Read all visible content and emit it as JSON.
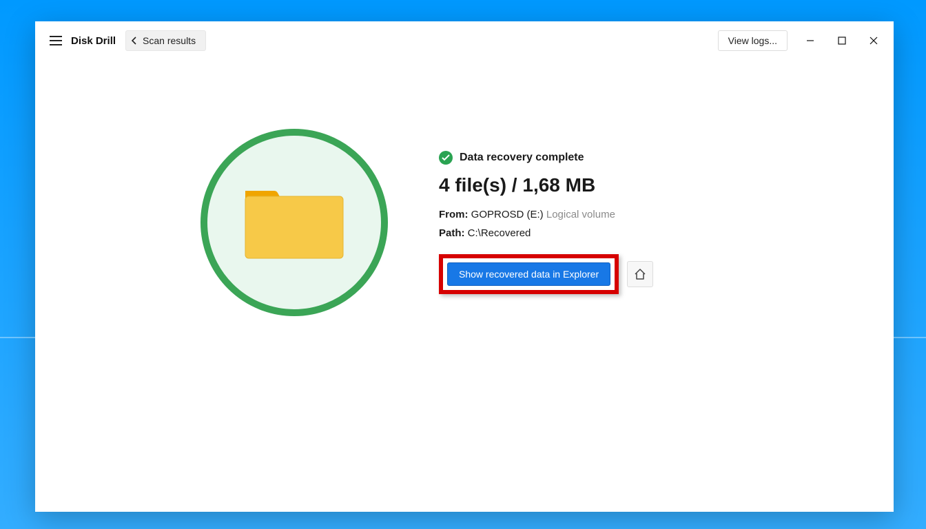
{
  "header": {
    "app_title": "Disk Drill",
    "scan_results_label": "Scan results",
    "view_logs_label": "View logs..."
  },
  "result": {
    "status_text": "Data recovery complete",
    "summary": "4 file(s) / 1,68 MB",
    "from_label": "From:",
    "from_value": "GOPROSD (E:)",
    "from_extra": "Logical volume",
    "path_label": "Path:",
    "path_value": "C:\\Recovered",
    "show_button": "Show recovered data in Explorer"
  }
}
